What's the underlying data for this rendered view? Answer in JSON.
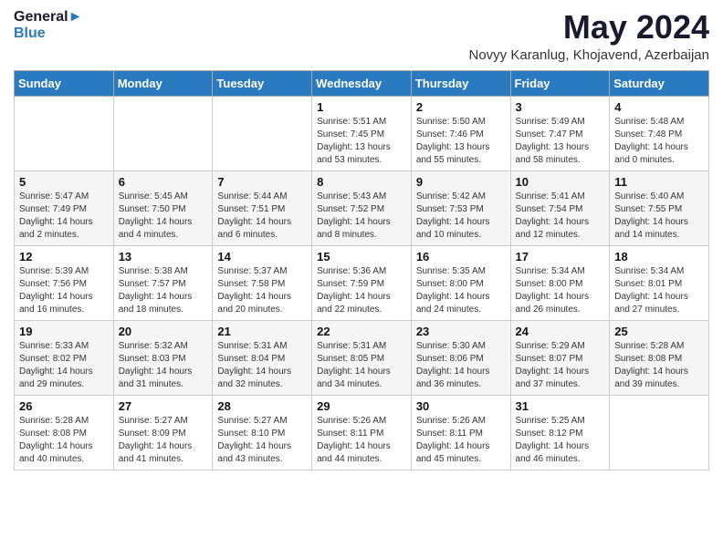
{
  "logo": {
    "line1": "General",
    "line2": "Blue"
  },
  "title": "May 2024",
  "location": "Novyy Karanlug, Khojavend, Azerbaijan",
  "days_of_week": [
    "Sunday",
    "Monday",
    "Tuesday",
    "Wednesday",
    "Thursday",
    "Friday",
    "Saturday"
  ],
  "weeks": [
    [
      {
        "day": "",
        "info": ""
      },
      {
        "day": "",
        "info": ""
      },
      {
        "day": "",
        "info": ""
      },
      {
        "day": "1",
        "info": "Sunrise: 5:51 AM\nSunset: 7:45 PM\nDaylight: 13 hours\nand 53 minutes."
      },
      {
        "day": "2",
        "info": "Sunrise: 5:50 AM\nSunset: 7:46 PM\nDaylight: 13 hours\nand 55 minutes."
      },
      {
        "day": "3",
        "info": "Sunrise: 5:49 AM\nSunset: 7:47 PM\nDaylight: 13 hours\nand 58 minutes."
      },
      {
        "day": "4",
        "info": "Sunrise: 5:48 AM\nSunset: 7:48 PM\nDaylight: 14 hours\nand 0 minutes."
      }
    ],
    [
      {
        "day": "5",
        "info": "Sunrise: 5:47 AM\nSunset: 7:49 PM\nDaylight: 14 hours\nand 2 minutes."
      },
      {
        "day": "6",
        "info": "Sunrise: 5:45 AM\nSunset: 7:50 PM\nDaylight: 14 hours\nand 4 minutes."
      },
      {
        "day": "7",
        "info": "Sunrise: 5:44 AM\nSunset: 7:51 PM\nDaylight: 14 hours\nand 6 minutes."
      },
      {
        "day": "8",
        "info": "Sunrise: 5:43 AM\nSunset: 7:52 PM\nDaylight: 14 hours\nand 8 minutes."
      },
      {
        "day": "9",
        "info": "Sunrise: 5:42 AM\nSunset: 7:53 PM\nDaylight: 14 hours\nand 10 minutes."
      },
      {
        "day": "10",
        "info": "Sunrise: 5:41 AM\nSunset: 7:54 PM\nDaylight: 14 hours\nand 12 minutes."
      },
      {
        "day": "11",
        "info": "Sunrise: 5:40 AM\nSunset: 7:55 PM\nDaylight: 14 hours\nand 14 minutes."
      }
    ],
    [
      {
        "day": "12",
        "info": "Sunrise: 5:39 AM\nSunset: 7:56 PM\nDaylight: 14 hours\nand 16 minutes."
      },
      {
        "day": "13",
        "info": "Sunrise: 5:38 AM\nSunset: 7:57 PM\nDaylight: 14 hours\nand 18 minutes."
      },
      {
        "day": "14",
        "info": "Sunrise: 5:37 AM\nSunset: 7:58 PM\nDaylight: 14 hours\nand 20 minutes."
      },
      {
        "day": "15",
        "info": "Sunrise: 5:36 AM\nSunset: 7:59 PM\nDaylight: 14 hours\nand 22 minutes."
      },
      {
        "day": "16",
        "info": "Sunrise: 5:35 AM\nSunset: 8:00 PM\nDaylight: 14 hours\nand 24 minutes."
      },
      {
        "day": "17",
        "info": "Sunrise: 5:34 AM\nSunset: 8:00 PM\nDaylight: 14 hours\nand 26 minutes."
      },
      {
        "day": "18",
        "info": "Sunrise: 5:34 AM\nSunset: 8:01 PM\nDaylight: 14 hours\nand 27 minutes."
      }
    ],
    [
      {
        "day": "19",
        "info": "Sunrise: 5:33 AM\nSunset: 8:02 PM\nDaylight: 14 hours\nand 29 minutes."
      },
      {
        "day": "20",
        "info": "Sunrise: 5:32 AM\nSunset: 8:03 PM\nDaylight: 14 hours\nand 31 minutes."
      },
      {
        "day": "21",
        "info": "Sunrise: 5:31 AM\nSunset: 8:04 PM\nDaylight: 14 hours\nand 32 minutes."
      },
      {
        "day": "22",
        "info": "Sunrise: 5:31 AM\nSunset: 8:05 PM\nDaylight: 14 hours\nand 34 minutes."
      },
      {
        "day": "23",
        "info": "Sunrise: 5:30 AM\nSunset: 8:06 PM\nDaylight: 14 hours\nand 36 minutes."
      },
      {
        "day": "24",
        "info": "Sunrise: 5:29 AM\nSunset: 8:07 PM\nDaylight: 14 hours\nand 37 minutes."
      },
      {
        "day": "25",
        "info": "Sunrise: 5:28 AM\nSunset: 8:08 PM\nDaylight: 14 hours\nand 39 minutes."
      }
    ],
    [
      {
        "day": "26",
        "info": "Sunrise: 5:28 AM\nSunset: 8:08 PM\nDaylight: 14 hours\nand 40 minutes."
      },
      {
        "day": "27",
        "info": "Sunrise: 5:27 AM\nSunset: 8:09 PM\nDaylight: 14 hours\nand 41 minutes."
      },
      {
        "day": "28",
        "info": "Sunrise: 5:27 AM\nSunset: 8:10 PM\nDaylight: 14 hours\nand 43 minutes."
      },
      {
        "day": "29",
        "info": "Sunrise: 5:26 AM\nSunset: 8:11 PM\nDaylight: 14 hours\nand 44 minutes."
      },
      {
        "day": "30",
        "info": "Sunrise: 5:26 AM\nSunset: 8:11 PM\nDaylight: 14 hours\nand 45 minutes."
      },
      {
        "day": "31",
        "info": "Sunrise: 5:25 AM\nSunset: 8:12 PM\nDaylight: 14 hours\nand 46 minutes."
      },
      {
        "day": "",
        "info": ""
      }
    ]
  ]
}
